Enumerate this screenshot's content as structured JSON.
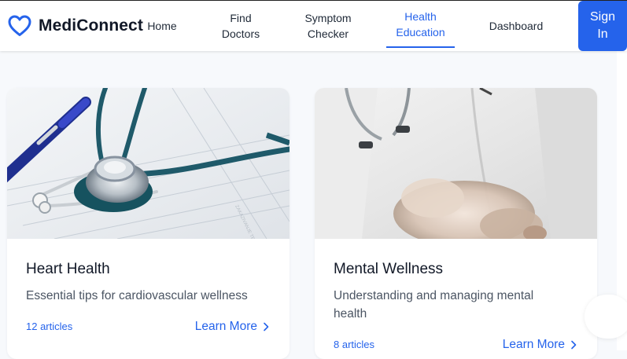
{
  "brand": {
    "name": "MediConnect",
    "icon": "heart-outline-icon",
    "color": "#2563eb"
  },
  "nav": {
    "home": [
      "Home"
    ],
    "find_doctors": [
      "Find",
      "Doctors"
    ],
    "symptom_checker": [
      "Symptom",
      "Checker"
    ],
    "health_education": [
      "Health",
      "Education"
    ],
    "dashboard": [
      "Dashboard"
    ],
    "active": "health_education"
  },
  "signin": [
    "Sign",
    "In"
  ],
  "cards": [
    {
      "title": "Heart Health",
      "description": "Essential tips for cardiovascular wellness",
      "count": "12 articles",
      "link": "Learn More",
      "image": "stethoscope-on-medical-chart-image"
    },
    {
      "title": "Mental Wellness",
      "description": "Understanding and managing mental health",
      "count": "8 articles",
      "link": "Learn More",
      "image": "doctor-in-white-coat-with-gloves-image"
    }
  ],
  "colors": {
    "accent": "#2563eb",
    "background": "#f7f9fc",
    "text": "#1f2937"
  }
}
